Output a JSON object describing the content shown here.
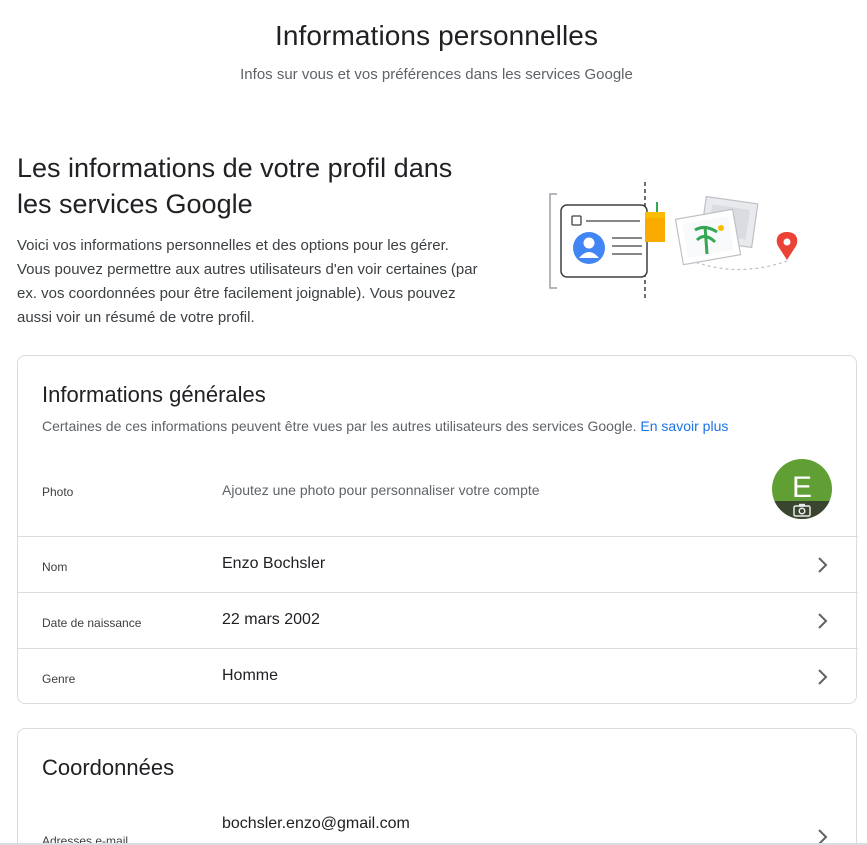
{
  "header": {
    "title": "Informations personnelles",
    "subtitle": "Infos sur vous et vos préférences dans les services Google"
  },
  "intro": {
    "title": "Les informations de votre profil dans les services Google",
    "description": "Voici vos informations personnelles et des options pour les gé­rer. Vous pouvez permettre aux autres utilisateurs d'en voir cer­taines (par ex. vos coordonnées pour être facilement joi­gnable). Vous pouvez aussi voir un résumé de votre profil."
  },
  "general": {
    "title": "Informations générales",
    "description": "Certaines de ces informations peuvent être vues par les autres utilisateurs des services Google.",
    "learn_more": "En savoir plus",
    "rows": [
      {
        "label": "Photo",
        "value": "Ajoutez une photo pour personnaliser votre compte"
      },
      {
        "label": "Nom",
        "value": "Enzo Bochsler"
      },
      {
        "label": "Date de naissance",
        "value": "22 mars 2002"
      },
      {
        "label": "Genre",
        "value": "Homme"
      }
    ],
    "avatar_letter": "E"
  },
  "contact": {
    "title": "Coordonnées",
    "rows": [
      {
        "label": "Adresses e-mail",
        "value": "bochsler.enzo@gmail.com"
      }
    ]
  },
  "colors": {
    "link": "#1a73e8",
    "avatar": "#5f9f33",
    "divider": "#dadce0"
  },
  "icons": {
    "chevron": "chevron-right-icon",
    "camera": "camera-icon"
  }
}
